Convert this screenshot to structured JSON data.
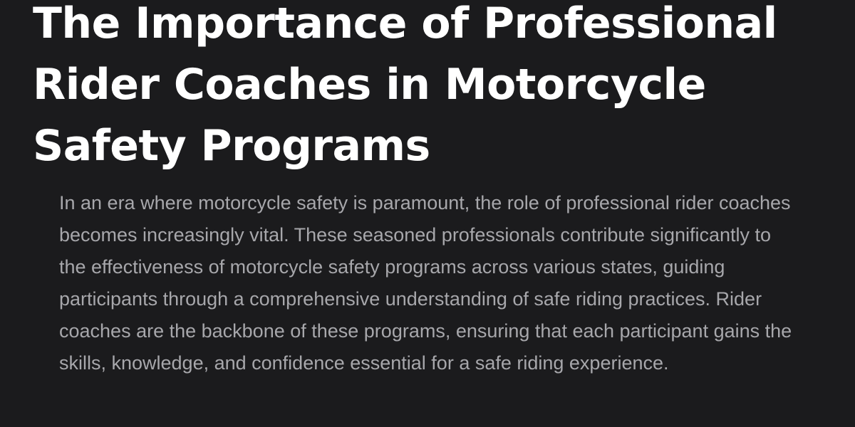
{
  "article": {
    "title": "The Importance of Professional Rider Coaches in Motorcycle Safety Programs",
    "lead": "In an era where motorcycle safety is paramount, the role of professional rider coaches becomes increasingly vital. These seasoned professionals contribute significantly to the effectiveness of motorcycle safety programs across various states, guiding participants through a comprehensive understanding of safe riding practices. Rider coaches are the backbone of these programs, ensuring that each participant gains the skills, knowledge, and confidence essential for a safe riding experience."
  },
  "colors": {
    "background": "#1b1b1d",
    "title": "#ffffff",
    "body_text": "#a7a7ab"
  }
}
